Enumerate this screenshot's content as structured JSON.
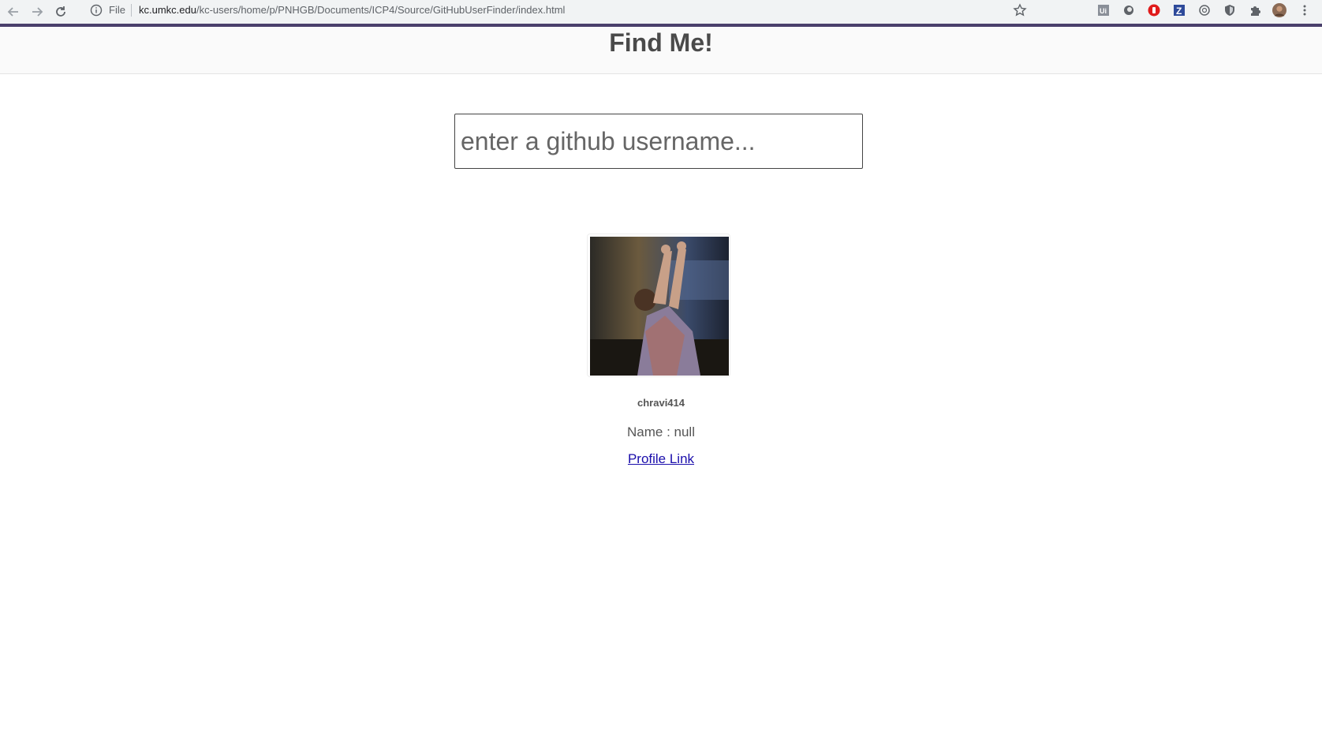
{
  "browser": {
    "scheme_label": "File",
    "url_host": "kc.umkc.edu",
    "url_path": "/kc-users/home/p/PNHGB/Documents/ICP4/Source/GitHubUserFinder/index.html",
    "extensions": [
      "ui-extension-icon",
      "circle-extension-icon",
      "stop-extension-icon",
      "z-extension-icon",
      "ring-extension-icon",
      "shield-extension-icon",
      "puzzle-icon",
      "profile-avatar-icon",
      "menu-dots-icon"
    ]
  },
  "header": {
    "title": "Find Me!"
  },
  "search": {
    "placeholder": "enter a github username..."
  },
  "profile": {
    "username": "chravi414",
    "name_line": "Name : null",
    "link_label": "Profile Link"
  },
  "colors": {
    "accent": "#4a3f6b",
    "link": "#1a0dab",
    "text": "#555555"
  }
}
